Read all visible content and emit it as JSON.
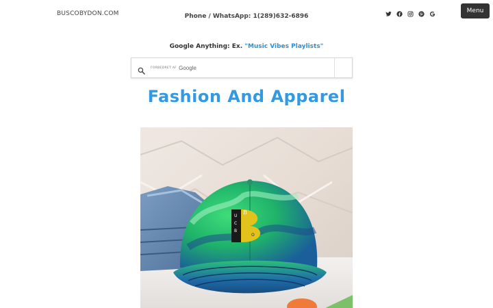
{
  "header": {
    "site_title": "BUSCOBYDON.COM",
    "phone": "Phone / WhatsApp: 1(289)632-6896",
    "socials": [
      "twitter-icon",
      "facebook-icon",
      "instagram-icon",
      "pinterest-icon",
      "google-icon"
    ],
    "menu_label": "Menu"
  },
  "search": {
    "prompt_prefix": "Google Anything: Ex. ",
    "prompt_example": "\"Music Vibes Playlists\"",
    "powered_by_prefix": "FORBEDRET AF",
    "powered_by_brand": "Google"
  },
  "main": {
    "heading": "Fashion And Apparel",
    "hero_image": "tie-dye-cap-photo",
    "cap_logo_letter": "B",
    "cap_logo_letters": [
      "U",
      "C",
      "B",
      "O"
    ]
  },
  "colors": {
    "accent": "#3499e0",
    "menu_bg": "#333333"
  }
}
